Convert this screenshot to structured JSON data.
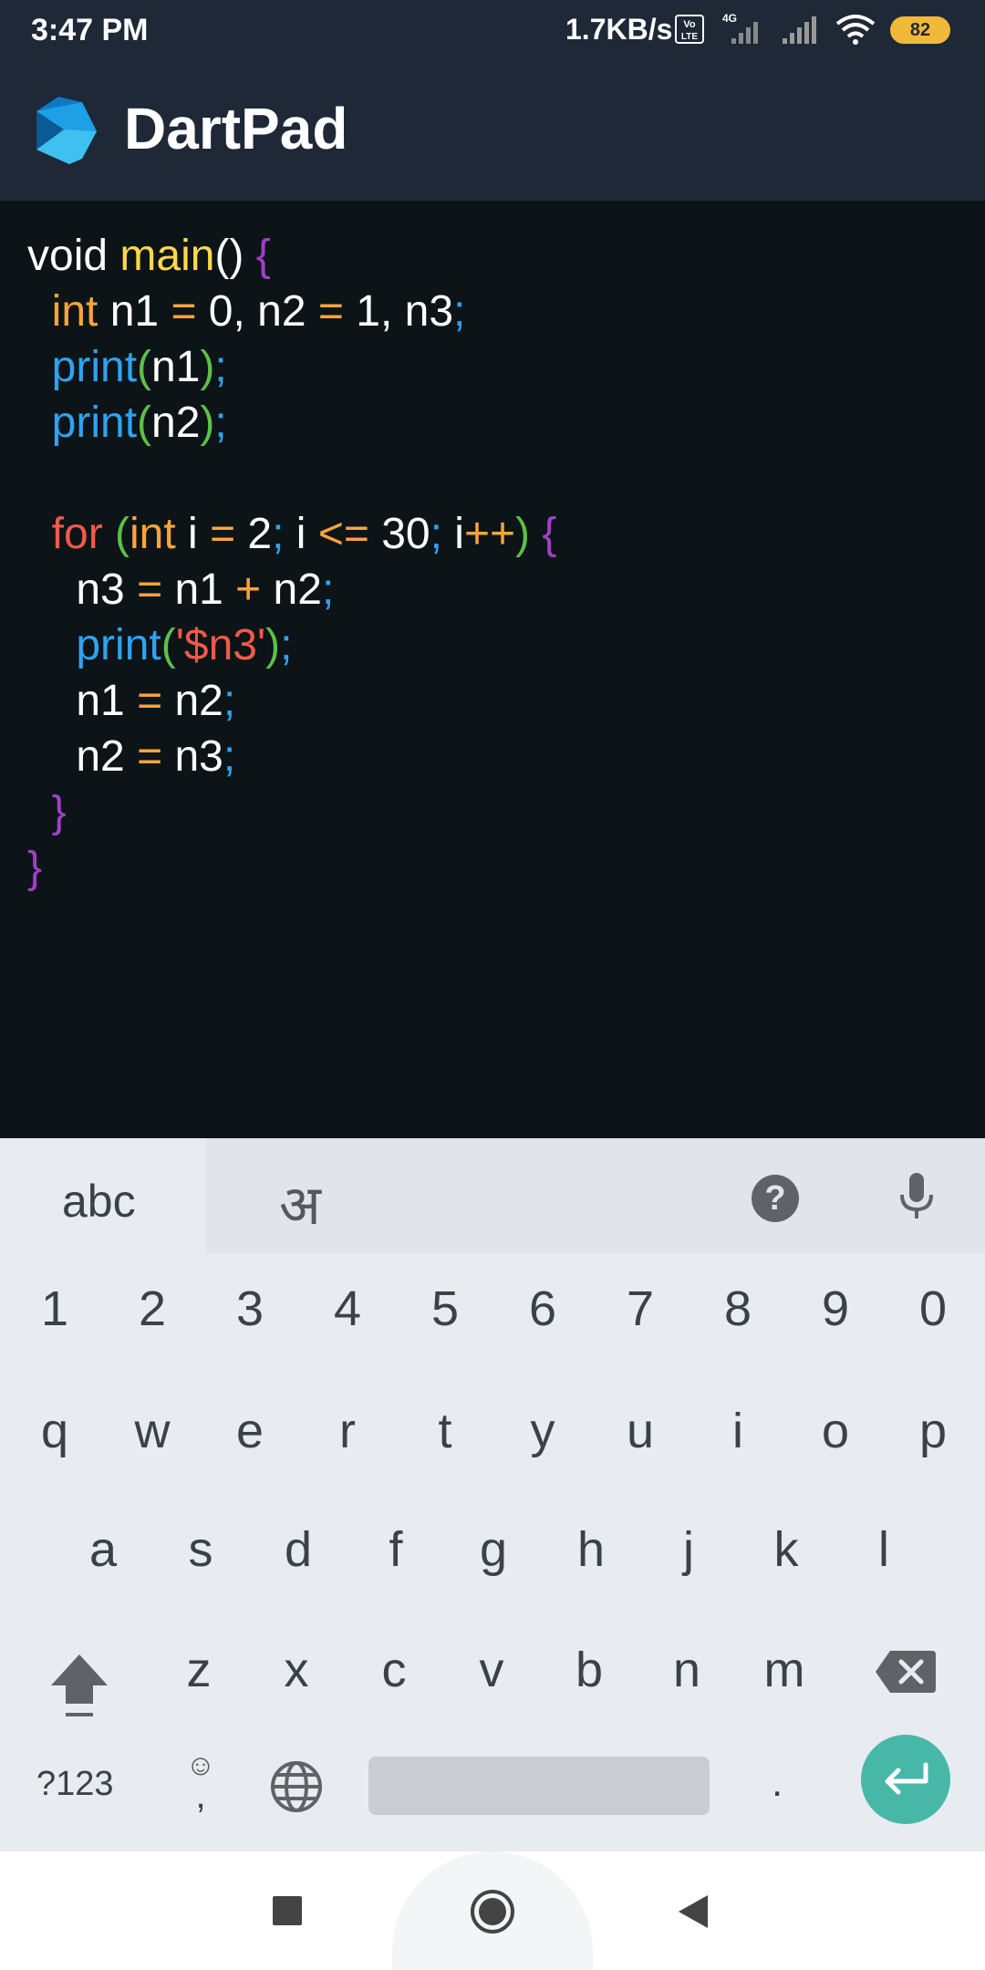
{
  "status_bar": {
    "time": "3:47 PM",
    "net_speed": "1.7KB/s",
    "volte": "Vo LTE",
    "network": "4G",
    "battery": "82"
  },
  "app_bar": {
    "title": "DartPad"
  },
  "editor": {
    "lines": [
      [
        {
          "t": "void ",
          "c": "plain"
        },
        {
          "t": "main",
          "c": "fn"
        },
        {
          "t": "() ",
          "c": "plain"
        },
        {
          "t": "{",
          "c": "brace"
        }
      ],
      [
        {
          "t": "  ",
          "c": "plain"
        },
        {
          "t": "int",
          "c": "kw"
        },
        {
          "t": " n1 ",
          "c": "plain"
        },
        {
          "t": "=",
          "c": "op"
        },
        {
          "t": " 0, n2 ",
          "c": "plain"
        },
        {
          "t": "=",
          "c": "op"
        },
        {
          "t": " 1, n3",
          "c": "plain"
        },
        {
          "t": ";",
          "c": "semi"
        }
      ],
      [
        {
          "t": "  ",
          "c": "plain"
        },
        {
          "t": "print",
          "c": "call"
        },
        {
          "t": "(",
          "c": "paren"
        },
        {
          "t": "n1",
          "c": "plain"
        },
        {
          "t": ")",
          "c": "paren"
        },
        {
          "t": ";",
          "c": "semi"
        }
      ],
      [
        {
          "t": "  ",
          "c": "plain"
        },
        {
          "t": "print",
          "c": "call"
        },
        {
          "t": "(",
          "c": "paren"
        },
        {
          "t": "n2",
          "c": "plain"
        },
        {
          "t": ")",
          "c": "paren"
        },
        {
          "t": ";",
          "c": "semi"
        }
      ],
      [],
      [
        {
          "t": "  ",
          "c": "plain"
        },
        {
          "t": "for",
          "c": "ctl"
        },
        {
          "t": " ",
          "c": "plain"
        },
        {
          "t": "(",
          "c": "paren"
        },
        {
          "t": "int",
          "c": "kw"
        },
        {
          "t": " i ",
          "c": "plain"
        },
        {
          "t": "=",
          "c": "op"
        },
        {
          "t": " 2",
          "c": "plain"
        },
        {
          "t": ";",
          "c": "semi"
        },
        {
          "t": " i ",
          "c": "plain"
        },
        {
          "t": "<=",
          "c": "op"
        },
        {
          "t": " 30",
          "c": "plain"
        },
        {
          "t": ";",
          "c": "semi"
        },
        {
          "t": " i",
          "c": "plain"
        },
        {
          "t": "++",
          "c": "op"
        },
        {
          "t": ")",
          "c": "paren"
        },
        {
          "t": " ",
          "c": "plain"
        },
        {
          "t": "{",
          "c": "brace"
        }
      ],
      [
        {
          "t": "    n3 ",
          "c": "plain"
        },
        {
          "t": "=",
          "c": "op"
        },
        {
          "t": " n1 ",
          "c": "plain"
        },
        {
          "t": "+",
          "c": "op"
        },
        {
          "t": " n2",
          "c": "plain"
        },
        {
          "t": ";",
          "c": "semi"
        }
      ],
      [
        {
          "t": "    ",
          "c": "plain"
        },
        {
          "t": "print",
          "c": "call"
        },
        {
          "t": "(",
          "c": "paren"
        },
        {
          "t": "'$n3'",
          "c": "str"
        },
        {
          "t": ")",
          "c": "paren"
        },
        {
          "t": ";",
          "c": "semi"
        }
      ],
      [
        {
          "t": "    n1 ",
          "c": "plain"
        },
        {
          "t": "=",
          "c": "op"
        },
        {
          "t": " n2",
          "c": "plain"
        },
        {
          "t": ";",
          "c": "semi"
        }
      ],
      [
        {
          "t": "    n2 ",
          "c": "plain"
        },
        {
          "t": "=",
          "c": "op"
        },
        {
          "t": " n3",
          "c": "plain"
        },
        {
          "t": ";",
          "c": "semi"
        }
      ],
      [
        {
          "t": "  ",
          "c": "plain"
        },
        {
          "t": "}",
          "c": "brace"
        }
      ],
      [
        {
          "t": "}",
          "c": "brace"
        }
      ]
    ]
  },
  "editor_keys": [
    {
      "name": "tab-key-button",
      "icon": "chevron-left-icon"
    },
    {
      "name": "cursor-left-button",
      "icon": "arrow-left-icon"
    },
    {
      "name": "cursor-up-button",
      "icon": "arrow-up-icon"
    },
    {
      "name": "cursor-down-button",
      "icon": "arrow-down-icon"
    },
    {
      "name": "cursor-right-button",
      "icon": "arrow-right-icon"
    },
    {
      "name": "run-button",
      "icon": "play-icon"
    }
  ],
  "keyboard": {
    "tab_abc": "abc",
    "tab_hindi": "अ",
    "help": "?",
    "row_numbers": [
      "1",
      "2",
      "3",
      "4",
      "5",
      "6",
      "7",
      "8",
      "9",
      "0"
    ],
    "row1": [
      "q",
      "w",
      "e",
      "r",
      "t",
      "y",
      "u",
      "i",
      "o",
      "p"
    ],
    "row2": [
      "a",
      "s",
      "d",
      "f",
      "g",
      "h",
      "j",
      "k",
      "l"
    ],
    "row3": [
      "z",
      "x",
      "c",
      "v",
      "b",
      "n",
      "m"
    ],
    "symbols": "?123",
    "emoji_comma_top": "☺",
    "emoji_comma_bottom": ",",
    "period": ".",
    "colors": {
      "enter": "#47b7a8",
      "accent": "#2196f3"
    }
  }
}
